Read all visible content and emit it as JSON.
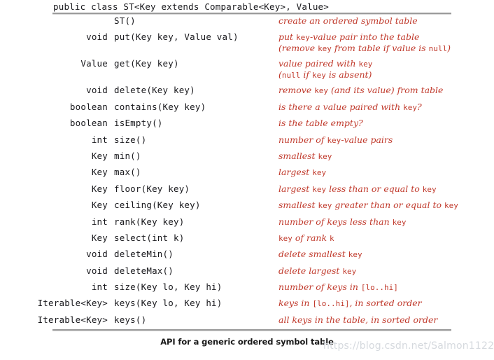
{
  "figure": {
    "class_header": "public class ST<Key extends Comparable<Key>, Value>",
    "caption": "API for a generic ordered symbol table",
    "watermark": "https://blog.csdn.net/Salmon1122",
    "accent_color": "#c0392b",
    "text_color": "#18181c",
    "rule_color": "#9b9b9b"
  },
  "rows": [
    {
      "ret": "",
      "sig": "ST()",
      "desc_line1": "create an ordered symbol table",
      "desc_line2": ""
    },
    {
      "ret": "void",
      "sig": "put(Key key, Value val)",
      "desc_line1": "put key-value pair into the table",
      "desc_line2": "(remove key from table if value is null)"
    },
    {
      "ret": "Value",
      "sig": "get(Key key)",
      "desc_line1": "value paired with key",
      "desc_line2": "(null if key is absent)"
    },
    {
      "ret": "void",
      "sig": "delete(Key key)",
      "desc_line1": "remove key (and its value) from table",
      "desc_line2": ""
    },
    {
      "ret": "boolean",
      "sig": "contains(Key key)",
      "desc_line1": "is there a value paired with key?",
      "desc_line2": ""
    },
    {
      "ret": "boolean",
      "sig": "isEmpty()",
      "desc_line1": "is the table empty?",
      "desc_line2": ""
    },
    {
      "ret": "int",
      "sig": "size()",
      "desc_line1": "number of key-value pairs",
      "desc_line2": ""
    },
    {
      "ret": "Key",
      "sig": "min()",
      "desc_line1": "smallest key",
      "desc_line2": ""
    },
    {
      "ret": "Key",
      "sig": "max()",
      "desc_line1": "largest key",
      "desc_line2": ""
    },
    {
      "ret": "Key",
      "sig": "floor(Key key)",
      "desc_line1": "largest key less than or equal to key",
      "desc_line2": ""
    },
    {
      "ret": "Key",
      "sig": "ceiling(Key key)",
      "desc_line1": "smallest key greater than or equal to key",
      "desc_line2": ""
    },
    {
      "ret": "int",
      "sig": "rank(Key key)",
      "desc_line1": "number of keys less than key",
      "desc_line2": ""
    },
    {
      "ret": "Key",
      "sig": "select(int k)",
      "desc_line1": "key of rank k",
      "desc_line2": ""
    },
    {
      "ret": "void",
      "sig": "deleteMin()",
      "desc_line1": "delete smallest key",
      "desc_line2": ""
    },
    {
      "ret": "void",
      "sig": "deleteMax()",
      "desc_line1": "delete largest key",
      "desc_line2": ""
    },
    {
      "ret": "int",
      "sig": "size(Key lo, Key hi)",
      "desc_line1": "number of keys in [lo..hi]",
      "desc_line2": ""
    },
    {
      "ret": "Iterable<Key>",
      "sig": "keys(Key lo, Key hi)",
      "desc_line1": "keys in [lo..hi], in sorted order",
      "desc_line2": ""
    },
    {
      "ret": "Iterable<Key>",
      "sig": "keys()",
      "desc_line1": "all keys in the table, in sorted order",
      "desc_line2": ""
    }
  ]
}
